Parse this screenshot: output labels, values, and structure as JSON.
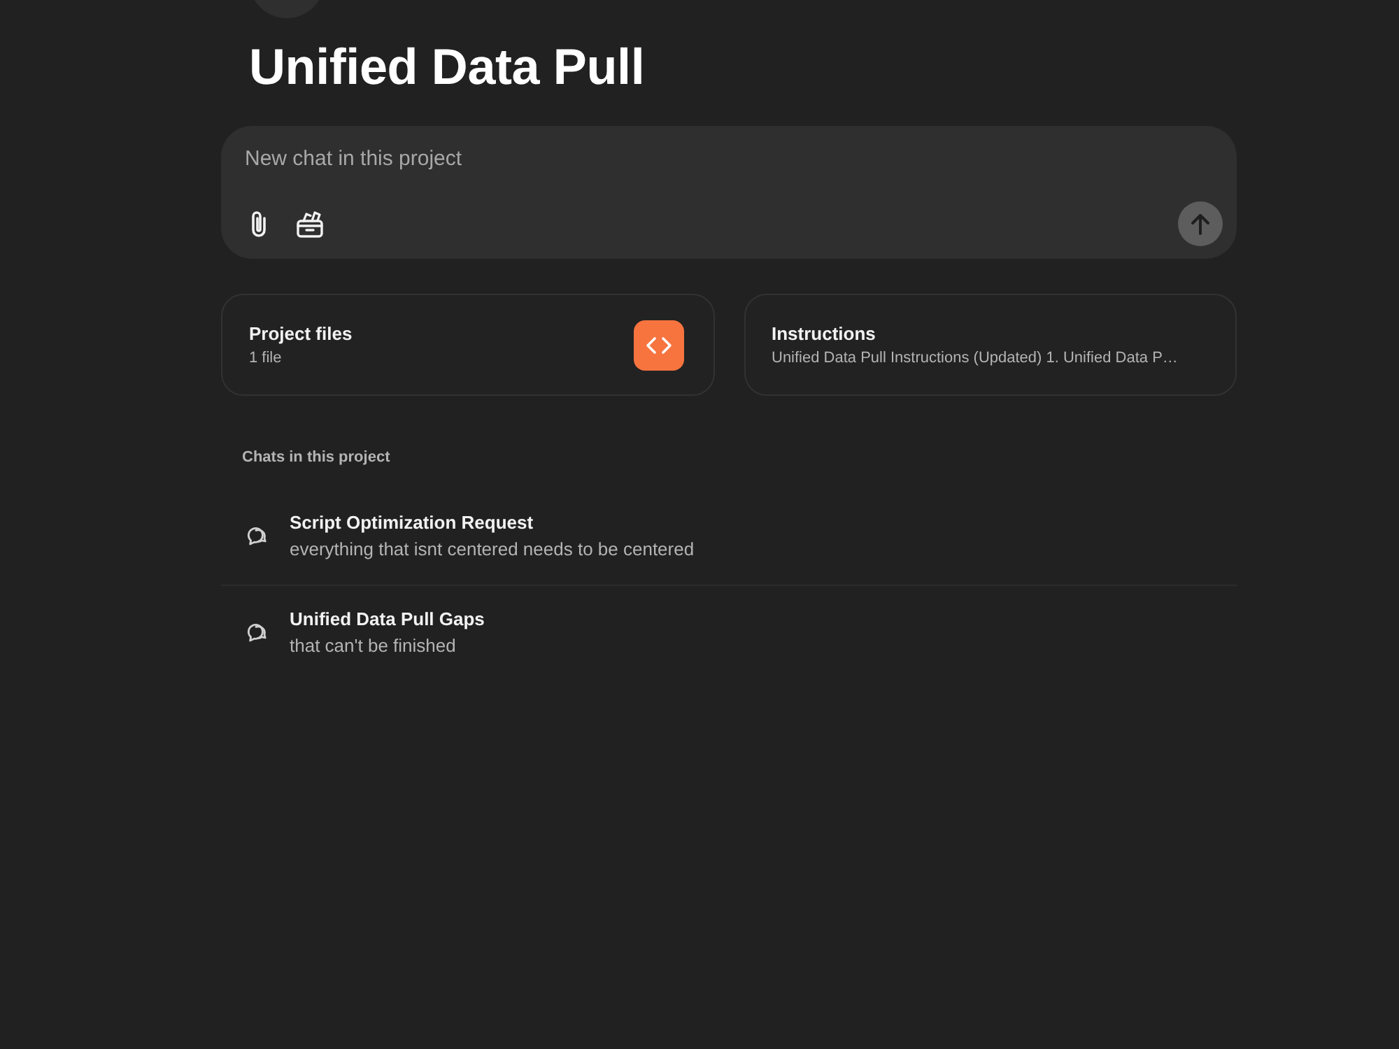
{
  "header": {
    "title": "Unified Data Pull"
  },
  "composer": {
    "placeholder": "New chat in this project"
  },
  "cards": [
    {
      "kind": "files",
      "title": "Project files",
      "subtitle": "1 file"
    },
    {
      "kind": "text",
      "title": "Instructions",
      "subtitle": "Unified Data Pull Instructions (Updated) 1. Unified Data P…"
    }
  ],
  "chats": {
    "heading": "Chats in this project",
    "items": [
      {
        "title": "Script Optimization Request",
        "subtitle": "everything that isnt centered needs to be centered"
      },
      {
        "title": "Unified Data Pull Gaps",
        "subtitle": "that can't be finished"
      }
    ]
  }
}
